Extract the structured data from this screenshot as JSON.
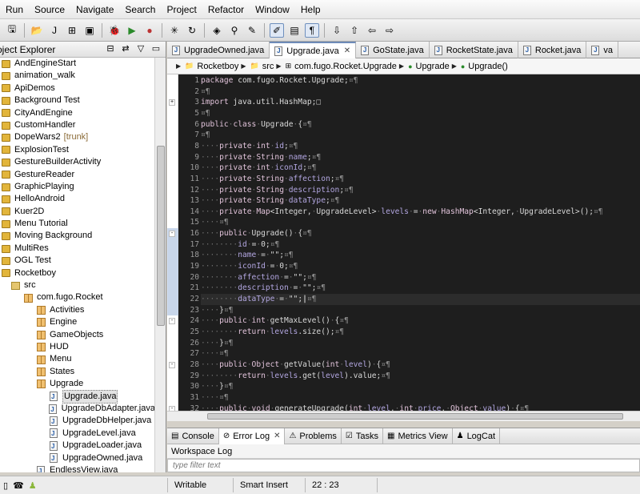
{
  "menu": [
    "Run",
    "Source",
    "Navigate",
    "Search",
    "Project",
    "Refactor",
    "Window",
    "Help"
  ],
  "explorer": {
    "title": "oject Explorer",
    "items": [
      {
        "label": "AndEngineStart",
        "kind": "project",
        "indent": 0
      },
      {
        "label": "animation_walk",
        "kind": "project",
        "indent": 0
      },
      {
        "label": "ApiDemos",
        "kind": "project",
        "indent": 0
      },
      {
        "label": "Background Test",
        "kind": "project",
        "indent": 0
      },
      {
        "label": "CityAndEngine",
        "kind": "project",
        "indent": 0
      },
      {
        "label": "CustomHandler",
        "kind": "project",
        "indent": 0
      },
      {
        "label": "DopeWars2",
        "tag": "[trunk]",
        "kind": "project",
        "indent": 0
      },
      {
        "label": "ExplosionTest",
        "kind": "project",
        "indent": 0
      },
      {
        "label": "GestureBuilderActivity",
        "kind": "project",
        "indent": 0
      },
      {
        "label": "GestureReader",
        "kind": "project",
        "indent": 0
      },
      {
        "label": "GraphicPlaying",
        "kind": "project",
        "indent": 0
      },
      {
        "label": "HelloAndroid",
        "kind": "project",
        "indent": 0
      },
      {
        "label": "Kuer2D",
        "kind": "project",
        "indent": 0
      },
      {
        "label": "Menu Tutorial",
        "kind": "project",
        "indent": 0
      },
      {
        "label": "Moving Background",
        "kind": "project",
        "indent": 0
      },
      {
        "label": "MultiRes",
        "kind": "project",
        "indent": 0
      },
      {
        "label": "OGL Test",
        "kind": "project",
        "indent": 0
      },
      {
        "label": "Rocketboy",
        "kind": "project",
        "indent": 0
      },
      {
        "label": "src",
        "kind": "src",
        "indent": 1
      },
      {
        "label": "com.fugo.Rocket",
        "kind": "package",
        "indent": 2
      },
      {
        "label": "Activities",
        "kind": "package",
        "indent": 3
      },
      {
        "label": "Engine",
        "kind": "package",
        "indent": 3
      },
      {
        "label": "GameObjects",
        "kind": "package",
        "indent": 3
      },
      {
        "label": "HUD",
        "kind": "package",
        "indent": 3
      },
      {
        "label": "Menu",
        "kind": "package",
        "indent": 3
      },
      {
        "label": "States",
        "kind": "package",
        "indent": 3
      },
      {
        "label": "Upgrade",
        "kind": "package",
        "indent": 3
      },
      {
        "label": "Upgrade.java",
        "kind": "file",
        "indent": 4,
        "selected": true
      },
      {
        "label": "UpgradeDbAdapter.java",
        "kind": "file",
        "indent": 4
      },
      {
        "label": "UpgradeDbHelper.java",
        "kind": "file",
        "indent": 4
      },
      {
        "label": "UpgradeLevel.java",
        "kind": "file",
        "indent": 4
      },
      {
        "label": "UpgradeLoader.java",
        "kind": "file",
        "indent": 4
      },
      {
        "label": "UpgradeOwned.java",
        "kind": "file",
        "indent": 4
      },
      {
        "label": "EndlessView.java",
        "kind": "file",
        "indent": 3
      }
    ]
  },
  "tabs": [
    {
      "label": "UpgradeOwned.java",
      "active": false
    },
    {
      "label": "Upgrade.java",
      "active": true
    },
    {
      "label": "GoState.java",
      "active": false
    },
    {
      "label": "RocketState.java",
      "active": false
    },
    {
      "label": "Rocket.java",
      "active": false
    },
    {
      "label": "va",
      "active": false
    }
  ],
  "breadcrumb": [
    "Rocketboy",
    "src",
    "com.fugo.Rocket.Upgrade",
    "Upgrade",
    "Upgrade()"
  ],
  "code": [
    {
      "n": "1",
      "html": "<span class='kw'>package</span> com.fugo.Rocket.Upgrade;<span class='ws'>¤¶</span>"
    },
    {
      "n": "2",
      "html": "<span class='ws'>¤¶</span>"
    },
    {
      "n": "3",
      "fold": "+",
      "html": "<span class='kw'>import</span> java.util.HashMap;<span class='box'>□</span>"
    },
    {
      "n": "5",
      "html": "<span class='ws'>¤¶</span>"
    },
    {
      "n": "6",
      "html": "<span class='kw'>public</span><span class='dot'>·</span><span class='kw'>class</span><span class='dot'>·</span>Upgrade<span class='dot'>·</span>{<span class='ws'>¤¶</span>"
    },
    {
      "n": "7",
      "html": "<span class='ws'>¤¶</span>"
    },
    {
      "n": "8",
      "html": "<span class='dot'>····</span><span class='kw'>private</span><span class='dot'>·</span><span class='kw'>int</span><span class='dot'>·</span><span class='fld'>id</span>;<span class='ws'>¤¶</span>"
    },
    {
      "n": "9",
      "html": "<span class='dot'>····</span><span class='kw'>private</span><span class='dot'>·</span><span class='kw'>String</span><span class='dot'>·</span><span class='fld'>name</span>;<span class='ws'>¤¶</span>"
    },
    {
      "n": "10",
      "html": "<span class='dot'>····</span><span class='kw'>private</span><span class='dot'>·</span><span class='kw'>int</span><span class='dot'>·</span><span class='fld'>iconId</span>;<span class='ws'>¤¶</span>"
    },
    {
      "n": "11",
      "html": "<span class='dot'>····</span><span class='kw'>private</span><span class='dot'>·</span><span class='kw'>String</span><span class='dot'>·</span><span class='fld'>affection</span>;<span class='ws'>¤¶</span>"
    },
    {
      "n": "12",
      "html": "<span class='dot'>····</span><span class='kw'>private</span><span class='dot'>·</span><span class='kw'>String</span><span class='dot'>·</span><span class='fld'>description</span>;<span class='ws'>¤¶</span>"
    },
    {
      "n": "13",
      "html": "<span class='dot'>····</span><span class='kw'>private</span><span class='dot'>·</span><span class='kw'>String</span><span class='dot'>·</span><span class='fld'>dataType</span>;<span class='ws'>¤¶</span>"
    },
    {
      "n": "14",
      "html": "<span class='dot'>····</span><span class='kw'>private</span><span class='dot'>·</span><span class='kw'>Map</span>&lt;Integer,<span class='dot'>·</span>UpgradeLevel&gt;<span class='dot'>·</span><span class='fld'>levels</span><span class='dot'>·</span>=<span class='dot'>·</span><span class='kw'>new</span><span class='dot'>·</span><span class='kw'>HashMap</span>&lt;Integer,<span class='dot'>·</span>UpgradeLevel&gt;();<span class='ws'>¤¶</span>"
    },
    {
      "n": "15",
      "html": "<span class='dot'>····</span><span class='ws'>¤¶</span>"
    },
    {
      "n": "16",
      "fold": "-",
      "hl": true,
      "html": "<span class='dot'>····</span><span class='kw'>public</span><span class='dot'>·</span><span class='fn'>Upgrade</span>()<span class='dot'>·</span>{<span class='ws'>¤¶</span>"
    },
    {
      "n": "17",
      "hl": true,
      "html": "<span class='dot'>········</span><span class='fld'>id</span><span class='dot'>·</span>=<span class='dot'>·</span>0;<span class='ws'>¤¶</span>"
    },
    {
      "n": "18",
      "hl": true,
      "html": "<span class='dot'>········</span><span class='fld'>name</span><span class='dot'>·</span>=<span class='dot'>·</span>\"\";<span class='ws'>¤¶</span>"
    },
    {
      "n": "19",
      "hl": true,
      "html": "<span class='dot'>········</span><span class='fld'>iconId</span><span class='dot'>·</span>=<span class='dot'>·</span>0;<span class='ws'>¤¶</span>"
    },
    {
      "n": "20",
      "hl": true,
      "html": "<span class='dot'>········</span><span class='fld'>affection</span><span class='dot'>·</span>=<span class='dot'>·</span>\"\";<span class='ws'>¤¶</span>"
    },
    {
      "n": "21",
      "hl": true,
      "html": "<span class='dot'>········</span><span class='fld'>description</span><span class='dot'>·</span>=<span class='dot'>·</span>\"\";<span class='ws'>¤¶</span>"
    },
    {
      "n": "22",
      "hl": true,
      "cur": true,
      "html": "<span class='dot'>········</span><span class='fld'>dataType</span><span class='dot'>·</span>=<span class='dot'>·</span>\"\";<span class='caret'>|</span><span class='ws'>¤¶</span>"
    },
    {
      "n": "23",
      "hl": true,
      "html": "<span class='dot'>····</span>}<span class='ws'>¤¶</span>"
    },
    {
      "n": "24",
      "fold": "-",
      "html": "<span class='dot'>····</span><span class='kw'>public</span><span class='dot'>·</span><span class='kw'>int</span><span class='dot'>·</span><span class='fn'>getMaxLevel</span>()<span class='dot'>·</span>{<span class='ws'>¤¶</span>"
    },
    {
      "n": "25",
      "html": "<span class='dot'>········</span><span class='kw'>return</span><span class='dot'>·</span><span class='fld'>levels</span>.size();<span class='ws'>¤¶</span>"
    },
    {
      "n": "26",
      "html": "<span class='dot'>····</span>}<span class='ws'>¤¶</span>"
    },
    {
      "n": "27",
      "html": "<span class='dot'>····</span><span class='ws'>¤¶</span>"
    },
    {
      "n": "28",
      "fold": "-",
      "html": "<span class='dot'>····</span><span class='kw'>public</span><span class='dot'>·</span><span class='kw'>Object</span><span class='dot'>·</span><span class='fn'>getValue</span>(<span class='kw'>int</span><span class='dot'>·</span><span class='fld'>level</span>)<span class='dot'>·</span>{<span class='ws'>¤¶</span>"
    },
    {
      "n": "29",
      "html": "<span class='dot'>········</span><span class='kw'>return</span><span class='dot'>·</span><span class='fld'>levels</span>.get(<span class='fld'>level</span>).value;<span class='ws'>¤¶</span>"
    },
    {
      "n": "30",
      "html": "<span class='dot'>····</span>}<span class='ws'>¤¶</span>"
    },
    {
      "n": "31",
      "html": "<span class='dot'>····</span><span class='ws'>¤¶</span>"
    },
    {
      "n": "32",
      "fold": "-",
      "html": "<span class='dot'>····</span><span class='kw'>public</span><span class='dot'>·</span><span class='kw'>void</span><span class='dot'>·</span><span class='fn'>generateUpgrade</span>(<span class='kw'>int</span><span class='dot'>·</span><span class='fld'>level</span>,<span class='dot'>·</span><span class='kw'>int</span><span class='dot'>·</span><span class='fld'>price</span>,<span class='dot'>·</span><span class='kw'>Object</span><span class='dot'>·</span><span class='fld'>value</span>)<span class='dot'>·</span>{<span class='ws'>¤¶</span>"
    }
  ],
  "bottom": {
    "tabs": [
      {
        "label": "Console",
        "icon": "console-icon"
      },
      {
        "label": "Error Log",
        "icon": "error-log-icon",
        "active": true,
        "closable": true
      },
      {
        "label": "Problems",
        "icon": "problems-icon"
      },
      {
        "label": "Tasks",
        "icon": "tasks-icon"
      },
      {
        "label": "Metrics View",
        "icon": "metrics-icon"
      },
      {
        "label": "LogCat",
        "icon": "android-icon"
      }
    ],
    "workspace_log": "Workspace Log",
    "filter_placeholder": "type filter text"
  },
  "status": {
    "writable": "Writable",
    "insert_mode": "Smart Insert",
    "position": "22 : 23"
  },
  "colors": {
    "keyword": "#e0c2d9",
    "field": "#b2a6e0",
    "whitespace": "#6e6e6e",
    "editor_bg": "#1e1e1e"
  }
}
